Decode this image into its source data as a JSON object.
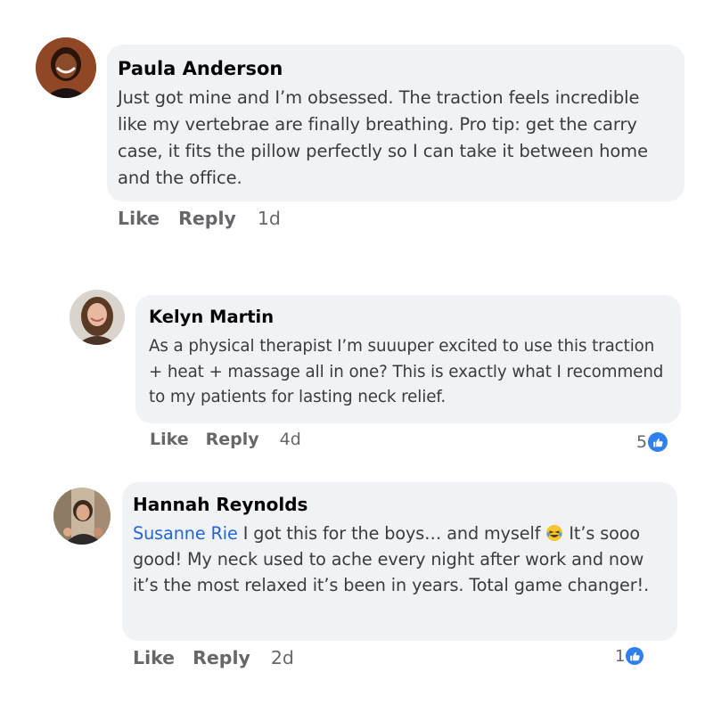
{
  "comments": [
    {
      "author": "Paula Anderson",
      "text": "Just got mine and I’m obsessed. The traction feels incredible like my vertebrae are finally breathing. Pro tip: get the carry case, it fits the pillow perfectly so I can take it between home and the office.",
      "like_label": "Like",
      "reply_label": "Reply",
      "time": "1d"
    },
    {
      "author": "Kelyn Martin",
      "text": "As a physical therapist I’m suuuper excited to use this traction + heat + massage all in one? This is exactly what I recommend to my patients for lasting neck relief.",
      "like_label": "Like",
      "reply_label": "Reply",
      "time": "4d",
      "reaction_count": "5",
      "reaction_icon": "thumbs-up-icon"
    },
    {
      "author": "Hannah Reynolds",
      "mention": "Susanne Rie",
      "text_before_emoji": "I got this for the boys… and myself",
      "emoji": "😂",
      "text_after_emoji": "It’s sooo good! My neck used to ache every night after work and now it’s the most relaxed it’s been in years. Total game changer!.",
      "like_label": "Like",
      "reply_label": "Reply",
      "time": "2d",
      "reaction_count": "1",
      "reaction_icon": "thumbs-up-icon"
    }
  ],
  "colors": {
    "bubble": "#f0f2f5",
    "mention": "#2166d4",
    "like_badge": "#2f80ed",
    "meta_text": "#65676b"
  }
}
